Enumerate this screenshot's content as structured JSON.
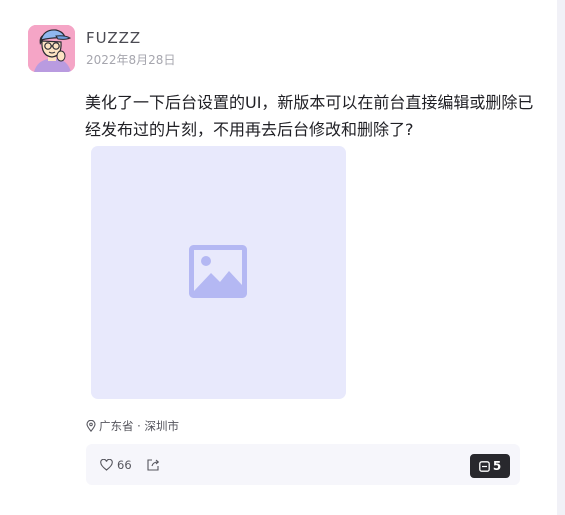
{
  "author": {
    "name": "FUZZZ",
    "date": "2022年8月28日",
    "avatar_icon": "cartoon-avatar",
    "avatar_bg": "#f5a5c6"
  },
  "post": {
    "text": "美化了一下后台设置的UI，新版本可以在前台直接编辑或删除已经发布过的片刻，不用再去后台修改和删除了?",
    "image_icon": "image-placeholder-icon",
    "image_bg": "#e8e9fc",
    "image_icon_color": "#b4b8f3"
  },
  "location": {
    "icon": "location-pin-icon",
    "text": "广东省 · 深圳市"
  },
  "actions": {
    "like_icon": "heart-icon",
    "like_count": "66",
    "share_icon": "share-icon",
    "comment_icon": "comment-icon",
    "comment_count": "5"
  }
}
